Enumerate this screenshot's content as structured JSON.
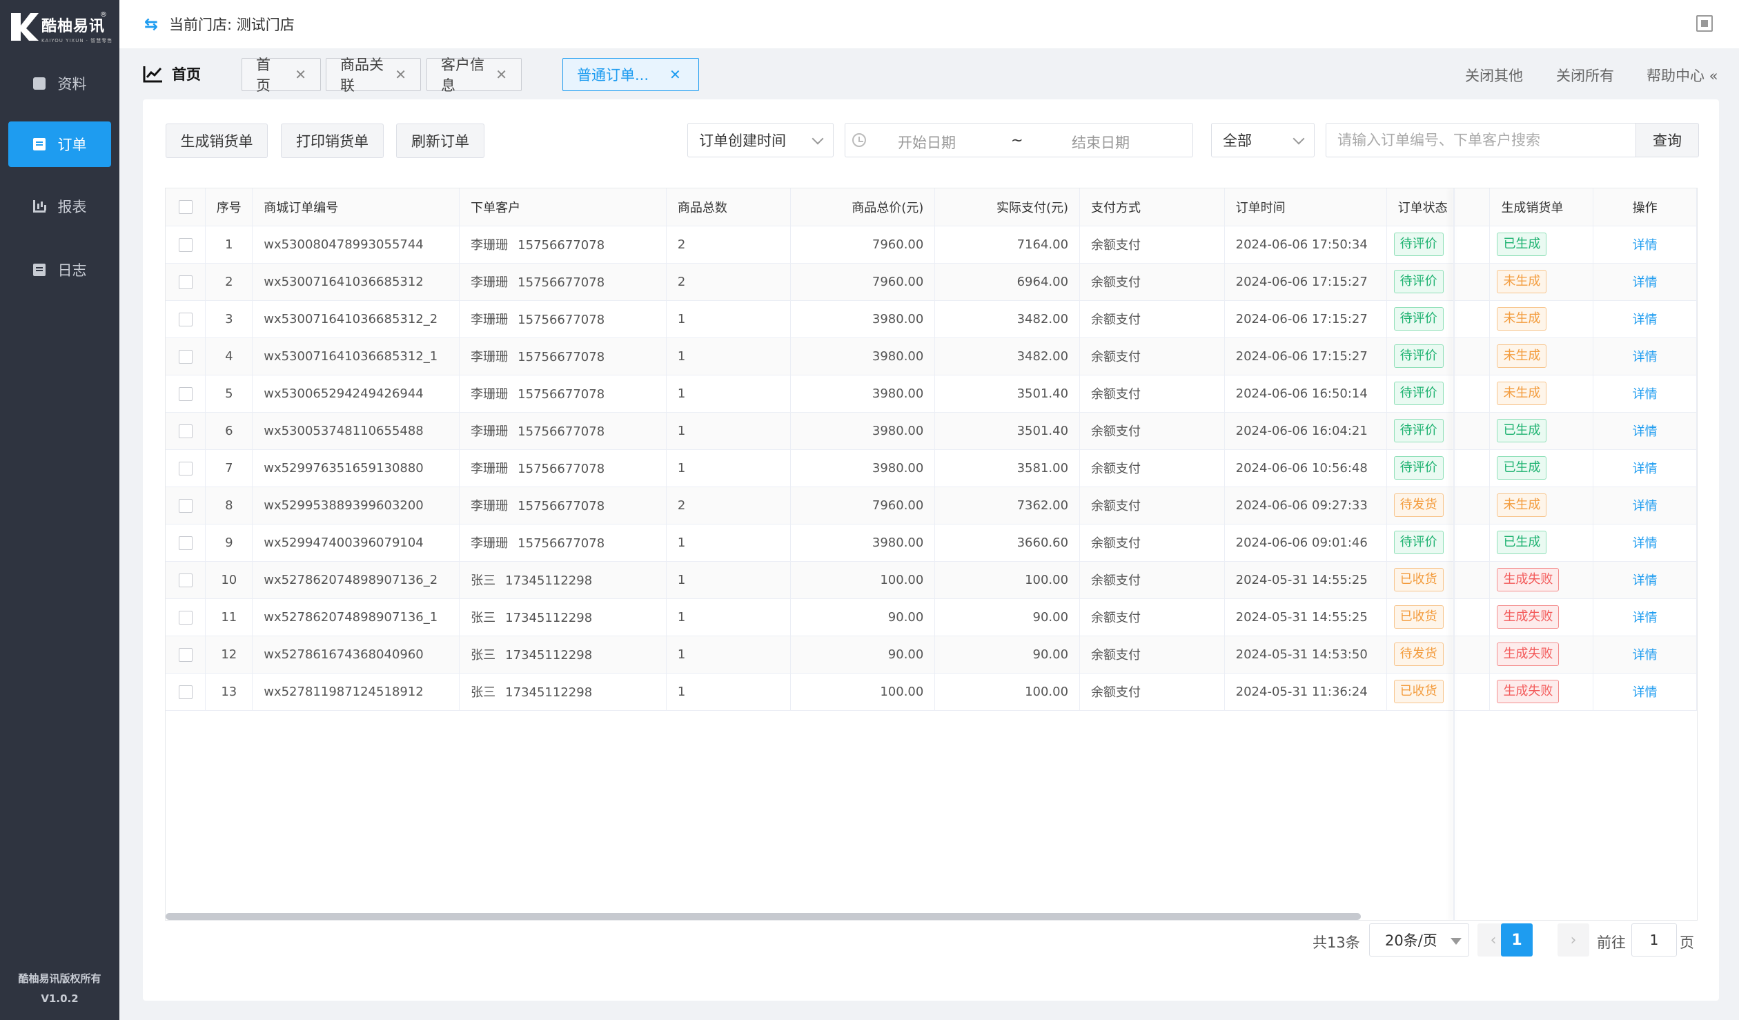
{
  "brand": {
    "name": "酷柚易讯",
    "subtitle": "KAIYOU YIXUN · 智慧零售",
    "registered": "®"
  },
  "sidebar": {
    "items": [
      {
        "label": "资料",
        "icon": "box-icon"
      },
      {
        "label": "订单",
        "icon": "document-icon",
        "active": true
      },
      {
        "label": "报表",
        "icon": "bar-chart-icon"
      },
      {
        "label": "日志",
        "icon": "log-icon"
      }
    ],
    "copyright": "酷柚易讯版权所有",
    "version": "V1.0.2"
  },
  "topbar": {
    "store_label": "当前门店: 测试门店"
  },
  "tabbar": {
    "home_label": "首页",
    "tabs": [
      {
        "label": "首页"
      },
      {
        "label": "商品关联"
      },
      {
        "label": "客户信息"
      },
      {
        "label": "普通订单...",
        "active": true
      }
    ],
    "close_others": "关闭其他",
    "close_all": "关闭所有",
    "help": "帮助中心 «"
  },
  "toolbar": {
    "gen_label": "生成销货单",
    "print_label": "打印销货单",
    "refresh_label": "刷新订单",
    "time_type": "订单创建时间",
    "start_date": "开始日期",
    "separator": "~",
    "end_date": "结束日期",
    "status_filter": "全部",
    "search_placeholder": "请输入订单编号、下单客户搜索",
    "query_label": "查询"
  },
  "table": {
    "columns": [
      "序号",
      "商城订单编号",
      "下单客户",
      "商品总数",
      "商品总价(元)",
      "实际支付(元)",
      "支付方式",
      "订单时间",
      "订单状态",
      "生成销货单",
      "操作"
    ],
    "rows": [
      {
        "idx": "1",
        "order_no": "wx530080478993055744",
        "customer": "李珊珊",
        "phone": "15756677078",
        "qty": "2",
        "total": "7960.00",
        "paid": "7164.00",
        "pay_method": "余额支付",
        "time": "2024-06-06 17:50:34",
        "status": "待评价",
        "status_color": "green",
        "gen": "已生成",
        "gen_color": "green",
        "action": "详情"
      },
      {
        "idx": "2",
        "order_no": "wx530071641036685312",
        "customer": "李珊珊",
        "phone": "15756677078",
        "qty": "2",
        "total": "7960.00",
        "paid": "6964.00",
        "pay_method": "余额支付",
        "time": "2024-06-06 17:15:27",
        "status": "待评价",
        "status_color": "green",
        "gen": "未生成",
        "gen_color": "orange",
        "action": "详情"
      },
      {
        "idx": "3",
        "order_no": "wx530071641036685312_2",
        "customer": "李珊珊",
        "phone": "15756677078",
        "qty": "1",
        "total": "3980.00",
        "paid": "3482.00",
        "pay_method": "余额支付",
        "time": "2024-06-06 17:15:27",
        "status": "待评价",
        "status_color": "green",
        "gen": "未生成",
        "gen_color": "orange",
        "action": "详情"
      },
      {
        "idx": "4",
        "order_no": "wx530071641036685312_1",
        "customer": "李珊珊",
        "phone": "15756677078",
        "qty": "1",
        "total": "3980.00",
        "paid": "3482.00",
        "pay_method": "余额支付",
        "time": "2024-06-06 17:15:27",
        "status": "待评价",
        "status_color": "green",
        "gen": "未生成",
        "gen_color": "orange",
        "action": "详情"
      },
      {
        "idx": "5",
        "order_no": "wx530065294249426944",
        "customer": "李珊珊",
        "phone": "15756677078",
        "qty": "1",
        "total": "3980.00",
        "paid": "3501.40",
        "pay_method": "余额支付",
        "time": "2024-06-06 16:50:14",
        "status": "待评价",
        "status_color": "green",
        "gen": "未生成",
        "gen_color": "orange",
        "action": "详情"
      },
      {
        "idx": "6",
        "order_no": "wx530053748110655488",
        "customer": "李珊珊",
        "phone": "15756677078",
        "qty": "1",
        "total": "3980.00",
        "paid": "3501.40",
        "pay_method": "余额支付",
        "time": "2024-06-06 16:04:21",
        "status": "待评价",
        "status_color": "green",
        "gen": "已生成",
        "gen_color": "green",
        "action": "详情"
      },
      {
        "idx": "7",
        "order_no": "wx529976351659130880",
        "customer": "李珊珊",
        "phone": "15756677078",
        "qty": "1",
        "total": "3980.00",
        "paid": "3581.00",
        "pay_method": "余额支付",
        "time": "2024-06-06 10:56:48",
        "status": "待评价",
        "status_color": "green",
        "gen": "已生成",
        "gen_color": "green",
        "action": "详情"
      },
      {
        "idx": "8",
        "order_no": "wx529953889399603200",
        "customer": "李珊珊",
        "phone": "15756677078",
        "qty": "2",
        "total": "7960.00",
        "paid": "7362.00",
        "pay_method": "余额支付",
        "time": "2024-06-06 09:27:33",
        "status": "待发货",
        "status_color": "orange",
        "gen": "未生成",
        "gen_color": "orange",
        "action": "详情"
      },
      {
        "idx": "9",
        "order_no": "wx529947400396079104",
        "customer": "李珊珊",
        "phone": "15756677078",
        "qty": "1",
        "total": "3980.00",
        "paid": "3660.60",
        "pay_method": "余额支付",
        "time": "2024-06-06 09:01:46",
        "status": "待评价",
        "status_color": "green",
        "gen": "已生成",
        "gen_color": "green",
        "action": "详情"
      },
      {
        "idx": "10",
        "order_no": "wx527862074898907136_2",
        "customer": "张三",
        "phone": "17345112298",
        "qty": "1",
        "total": "100.00",
        "paid": "100.00",
        "pay_method": "余额支付",
        "time": "2024-05-31 14:55:25",
        "status": "已收货",
        "status_color": "orange",
        "gen": "生成失败",
        "gen_color": "red",
        "action": "详情"
      },
      {
        "idx": "11",
        "order_no": "wx527862074898907136_1",
        "customer": "张三",
        "phone": "17345112298",
        "qty": "1",
        "total": "90.00",
        "paid": "90.00",
        "pay_method": "余额支付",
        "time": "2024-05-31 14:55:25",
        "status": "已收货",
        "status_color": "orange",
        "gen": "生成失败",
        "gen_color": "red",
        "action": "详情"
      },
      {
        "idx": "12",
        "order_no": "wx527861674368040960",
        "customer": "张三",
        "phone": "17345112298",
        "qty": "1",
        "total": "90.00",
        "paid": "90.00",
        "pay_method": "余额支付",
        "time": "2024-05-31 14:53:50",
        "status": "待发货",
        "status_color": "orange",
        "gen": "生成失败",
        "gen_color": "red",
        "action": "详情"
      },
      {
        "idx": "13",
        "order_no": "wx527811987124518912",
        "customer": "张三",
        "phone": "17345112298",
        "qty": "1",
        "total": "100.00",
        "paid": "100.00",
        "pay_method": "余额支付",
        "time": "2024-05-31 11:36:24",
        "status": "已收货",
        "status_color": "orange",
        "gen": "生成失败",
        "gen_color": "red",
        "action": "详情"
      }
    ]
  },
  "pagination": {
    "total": "共13条",
    "page_size": "20条/页",
    "current": "1",
    "goto_label": "前往",
    "goto_value": "1",
    "page_suffix": "页"
  },
  "colors": {
    "accent": "#1e9cf0",
    "sidebar_bg": "#2f3440",
    "green": "#1db270",
    "orange": "#f39c3d",
    "red": "#f35a5a"
  }
}
